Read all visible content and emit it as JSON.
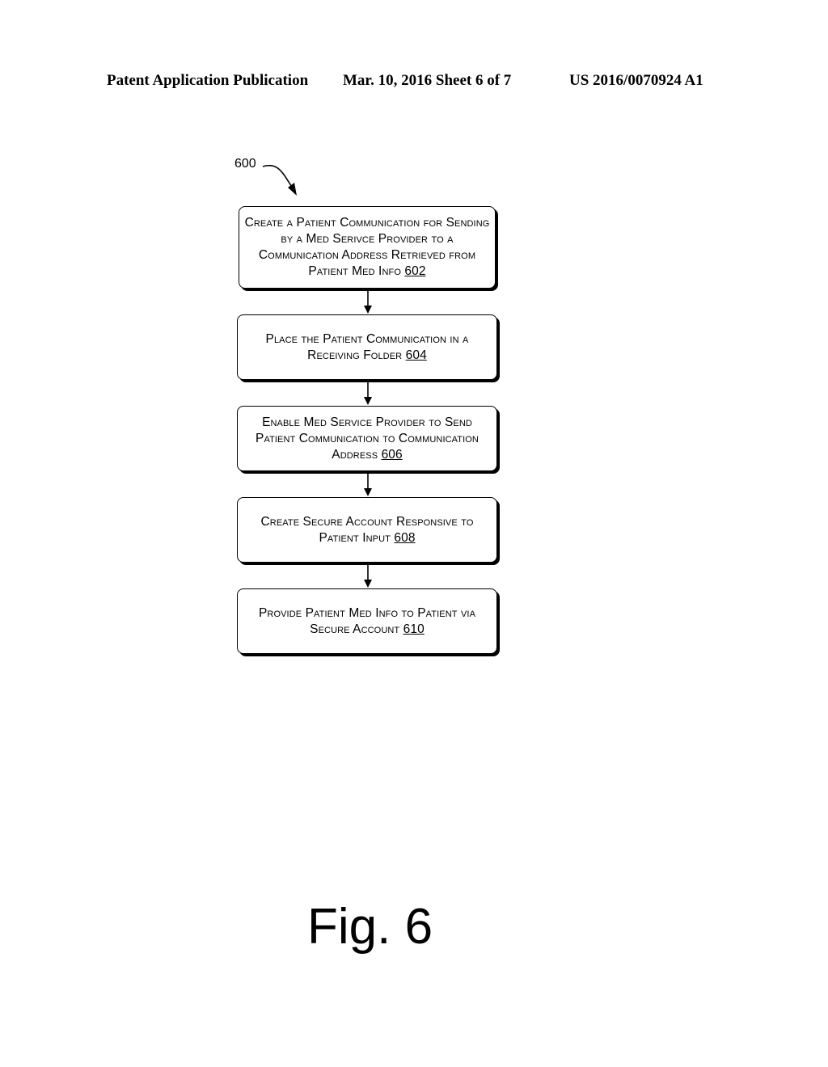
{
  "header": {
    "publication_type": "Patent Application Publication",
    "date_sheet": "Mar. 10, 2016  Sheet 6 of 7",
    "publication_number": "US 2016/0070924 A1"
  },
  "diagram": {
    "reference_number": "600",
    "steps": [
      {
        "text": "Create a Patient Communication for Sending by a Med Serivce Provider to a Communication Address Retrieved from Patient Med Info",
        "ref": "602"
      },
      {
        "text": "Place the Patient Communication in a Receiving Folder",
        "ref": "604"
      },
      {
        "text": "Enable Med Service Provider to Send Patient Communication to Communication Address ",
        "ref": "606"
      },
      {
        "text": "Create Secure Account Responsive to Patient Input",
        "ref": "608"
      },
      {
        "text": "Provide Patient Med Info to Patient via Secure Account",
        "ref": "610"
      }
    ],
    "connections": [
      {
        "from": "602",
        "to": "604"
      },
      {
        "from": "604",
        "to": "606"
      },
      {
        "from": "606",
        "to": "608"
      },
      {
        "from": "608",
        "to": "610"
      }
    ]
  },
  "figure_label": "Fig. 6"
}
